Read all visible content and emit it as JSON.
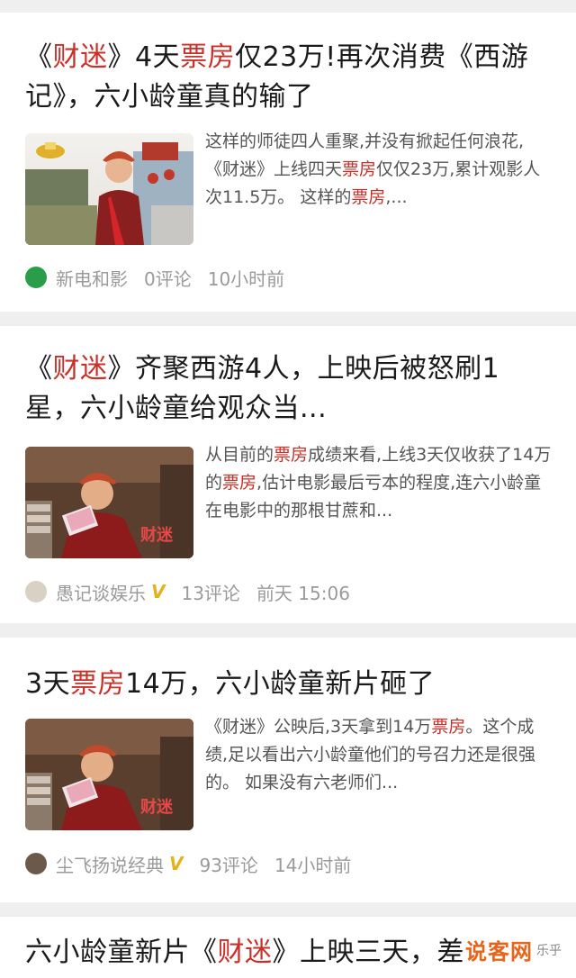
{
  "articles": [
    {
      "title_parts": [
        "《",
        "财迷",
        "》4天",
        "票房",
        "仅23万!再次消费《西游记》，六小龄童真的输了"
      ],
      "summary_parts": [
        "这样的师徒四人重聚,并没有掀起任何浪花,",
        "《财迷》",
        "上线四天",
        "票房",
        "仅仅23万,累计观影人次11.5万。 这样的",
        "票房",
        ",..."
      ],
      "source": "新电和影",
      "comments": "0评论",
      "time": "10小时前"
    },
    {
      "title_parts": [
        "《",
        "财迷",
        "》齐聚西游4人，上映后被怒刷1星，六小龄童给观众当..."
      ],
      "summary_parts": [
        "从目前的",
        "票房",
        "成绩来看,上线3天仅收获了14万的",
        "票房",
        ",估计电影最后亏本的程度,连六小龄童在电影中的那根甘蔗和..."
      ],
      "source": "愚记谈娱乐",
      "verified": "V",
      "comments": "13评论",
      "time": "前天 15:06"
    },
    {
      "title_parts": [
        "3天",
        "票房",
        "14万，六小龄童新片砸了"
      ],
      "summary_parts": [
        "《财迷》",
        "公映后,3天拿到14万",
        "票房",
        "。这个成绩,足以看出六小龄童他们的号召力还是很强的。 如果没有六老师们..."
      ],
      "source": "尘飞扬说经典",
      "verified": "V",
      "comments": "93评论",
      "time": "14小时前"
    },
    {
      "title_parts": [
        "六小龄童新片《",
        "财迷",
        "》上映三天，差"
      ]
    }
  ],
  "watermark": {
    "main": "说客网",
    "sub": "乐乎"
  },
  "colors": {
    "highlight": "#c8302a",
    "meta": "#9a9a9a",
    "verified": "#e3b21f"
  }
}
